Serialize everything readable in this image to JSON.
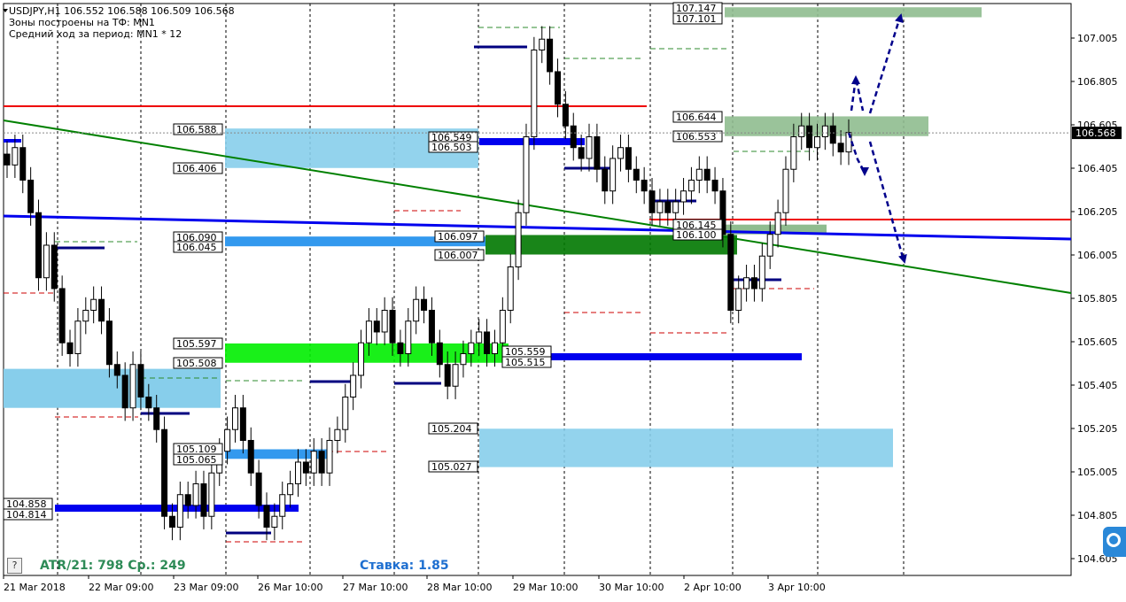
{
  "header": {
    "line1": "USDJPY,H1  106.552 106.588 106.509 106.568",
    "line2": "Зоны построены на ТФ: MN1",
    "line3": "Средний ход за период: MN1 * 12"
  },
  "stats": {
    "atr_label": "ATR/21: 798  Ср.: 249",
    "rate_label": "Ставка: 1.85"
  },
  "help_button": "?",
  "current_price": "106.568",
  "colors": {
    "lightblue_zone": "#87CEEB",
    "green_zone": "#8FBC8F",
    "bright_green": "#00EE00",
    "dark_green": "#007800",
    "blue_line": "#0000EE",
    "red_line": "#EE0000",
    "trend_green": "#008000",
    "arrow": "#00008B"
  },
  "chart_data": {
    "type": "candlestick",
    "symbol": "USDJPY",
    "timeframe": "H1",
    "ohlc_last": {
      "open": 106.552,
      "high": 106.588,
      "low": 106.509,
      "close": 106.568
    },
    "ylim": [
      104.63,
      107.28
    ],
    "y_ticks": [
      "107.005",
      "106.805",
      "106.605",
      "106.405",
      "106.205",
      "106.005",
      "105.805",
      "105.605",
      "105.405",
      "105.205",
      "105.005",
      "104.805",
      "104.605"
    ],
    "x_ticks": [
      "21 Mar 2018",
      "22 Mar 09:00",
      "23 Mar 09:00",
      "26 Mar 10:00",
      "27 Mar 10:00",
      "28 Mar 10:00",
      "29 Mar 10:00",
      "30 Mar 10:00",
      "2 Apr 10:00",
      "3 Apr 10:00"
    ],
    "price_labels": [
      "107.147",
      "107.101",
      "106.644",
      "106.553",
      "106.588",
      "106.406",
      "106.549",
      "106.503",
      "106.090",
      "106.045",
      "106.097",
      "106.007",
      "106.145",
      "106.100",
      "105.597",
      "105.508",
      "105.559",
      "105.515",
      "105.204",
      "105.027",
      "105.109",
      "105.065",
      "104.858",
      "104.814"
    ],
    "zones": [
      {
        "kind": "supply",
        "color": "green",
        "top": 107.147,
        "bottom": 107.101
      },
      {
        "kind": "supply",
        "color": "green",
        "top": 106.644,
        "bottom": 106.553
      },
      {
        "kind": "supply",
        "color": "lightblue",
        "top": 106.588,
        "bottom": 106.406
      },
      {
        "kind": "demand",
        "color": "lightblue",
        "top": 105.204,
        "bottom": 105.027
      },
      {
        "kind": "support",
        "color": "bright_green",
        "top": 105.597,
        "bottom": 105.508
      },
      {
        "kind": "support",
        "color": "dark_green",
        "top": 106.097,
        "bottom": 106.007
      }
    ],
    "closes": [
      106.42,
      106.5,
      106.35,
      106.2,
      105.9,
      106.05,
      105.85,
      105.6,
      105.55,
      105.7,
      105.75,
      105.8,
      105.7,
      105.5,
      105.45,
      105.3,
      105.5,
      105.35,
      105.3,
      105.2,
      104.8,
      104.75,
      104.9,
      104.85,
      104.95,
      104.8,
      105.0,
      105.1,
      105.2,
      105.3,
      105.15,
      105.0,
      104.85,
      104.75,
      104.8,
      104.9,
      104.95,
      105.05,
      105.0,
      105.1,
      105.0,
      105.15,
      105.2,
      105.35,
      105.45,
      105.6,
      105.7,
      105.65,
      105.75,
      105.6,
      105.55,
      105.7,
      105.8,
      105.75,
      105.6,
      105.5,
      105.4,
      105.5,
      105.55,
      105.6,
      105.65,
      105.55,
      105.6,
      105.75,
      105.95,
      106.2,
      106.55,
      106.95,
      107.0,
      106.85,
      106.7,
      106.6,
      106.5,
      106.45,
      106.55,
      106.4,
      106.3,
      106.45,
      106.5,
      106.4,
      106.35,
      106.3,
      106.2,
      106.25,
      106.2,
      106.25,
      106.3,
      106.35,
      106.4,
      106.35,
      106.3,
      106.1,
      105.75,
      105.85,
      105.9,
      105.85,
      106.0,
      106.1,
      106.2,
      106.4,
      106.55,
      106.6,
      106.5,
      106.55,
      106.6,
      106.52,
      106.48,
      106.57
    ]
  }
}
